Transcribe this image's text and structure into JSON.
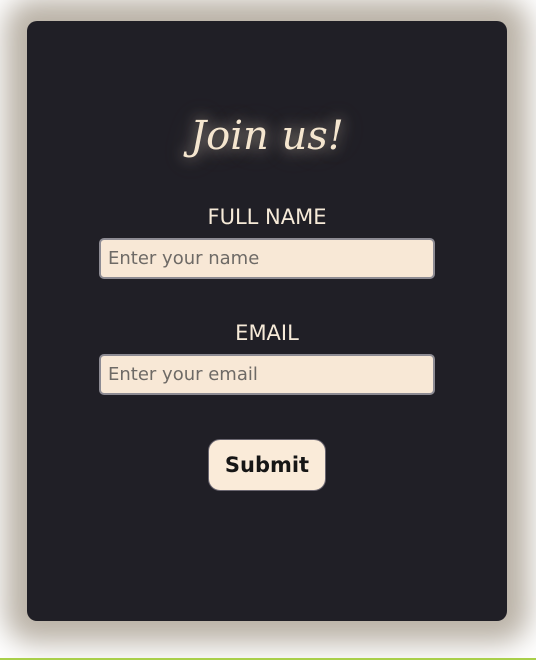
{
  "form": {
    "title": "Join us!",
    "name_label": "FULL NAME",
    "name_placeholder": "Enter your name",
    "email_label": "EMAIL",
    "email_placeholder": "Enter your email",
    "submit_label": "Submit"
  },
  "colors": {
    "card_background": "#201f26",
    "input_background": "#f8e8d6",
    "text_light": "#f6ead8",
    "glow": "#aea496"
  }
}
